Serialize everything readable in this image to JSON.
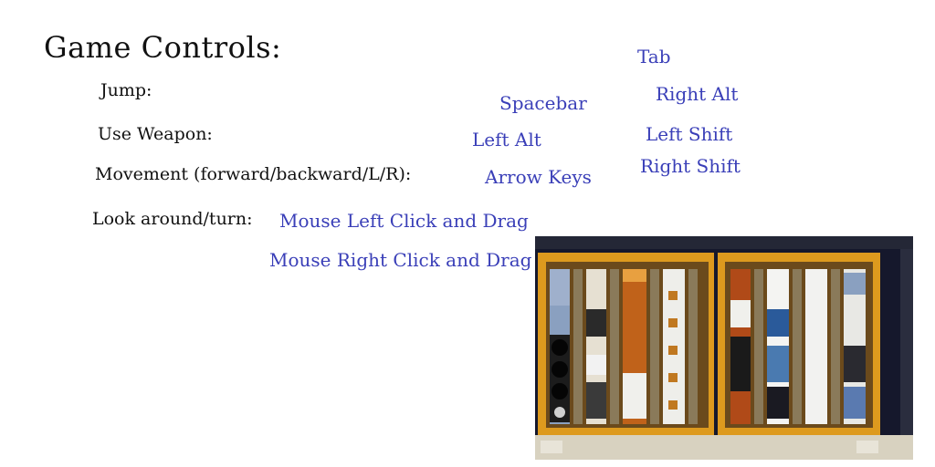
{
  "title": "Game Controls:",
  "labels": {
    "jump": "Jump:",
    "use_weapon": "Use Weapon:",
    "movement": "Movement (forward/backward/L/R):",
    "look": "Look around/turn:"
  },
  "keys": {
    "tab": "Tab",
    "right_alt": "Right Alt",
    "spacebar": "Spacebar",
    "left_alt": "Left Alt",
    "left_shift": "Left Shift",
    "right_shift": "Right Shift",
    "arrow_keys": "Arrow Keys",
    "mouse_left": "Mouse Left Click and Drag",
    "mouse_right": "Mouse Right Click and Drag"
  },
  "colors": {
    "label_text": "#111111",
    "key_text": "#3a3fb8",
    "panel_frame": "#e0a020"
  }
}
